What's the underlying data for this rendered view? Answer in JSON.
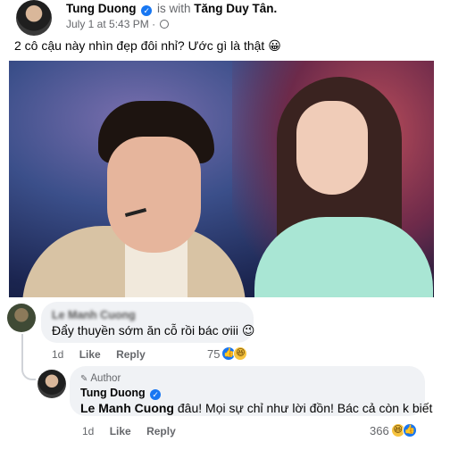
{
  "post": {
    "author": "Tung Duong",
    "with_prefix": "is with",
    "with_name": "Tăng Duy Tân.",
    "timestamp": "July 1 at 5:43 PM",
    "separator": "·",
    "text": "2 cô cậu này nhìn đẹp đôi nhỉ? Ước gì là thật 😀"
  },
  "comments": [
    {
      "name": "Le Manh Cuong",
      "text": "Đẩy thuyền sớm ăn cỗ rồi bác ơiii 😉",
      "time": "1d",
      "like_label": "Like",
      "reply_label": "Reply",
      "reaction_count": "75",
      "reactions": [
        "like",
        "haha"
      ]
    },
    {
      "author_label": "Author",
      "name": "Tung Duong",
      "mention": "Le Manh Cuong",
      "text": " đâu! Mọi sự chỉ như lời đồn! Bác cả còn k biết",
      "time": "1d",
      "like_label": "Like",
      "reply_label": "Reply",
      "reaction_count": "366",
      "reactions": [
        "haha",
        "like"
      ]
    }
  ],
  "icons": {
    "verified": "✓",
    "like": "👍",
    "haha": "😆",
    "pencil": "✎"
  },
  "colors": {
    "accent": "#1877f2",
    "secondary_text": "#65676b",
    "bubble_bg": "#f0f2f5"
  }
}
